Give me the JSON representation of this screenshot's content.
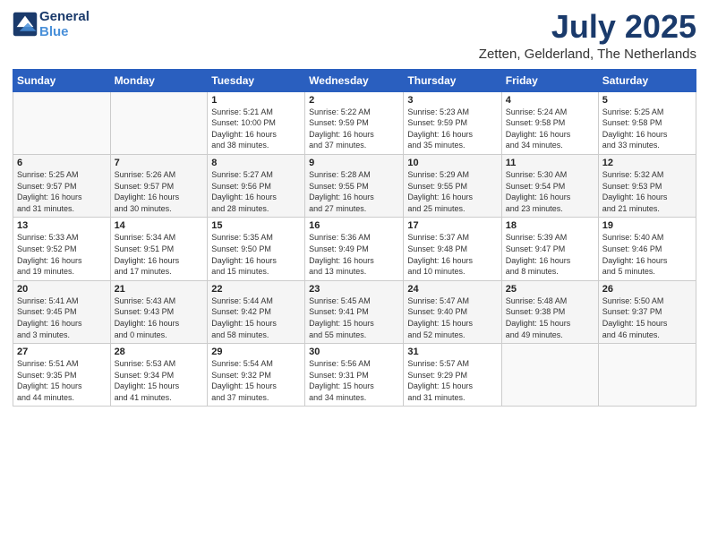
{
  "header": {
    "logo_line1": "General",
    "logo_line2": "Blue",
    "month_year": "July 2025",
    "location": "Zetten, Gelderland, The Netherlands"
  },
  "days_of_week": [
    "Sunday",
    "Monday",
    "Tuesday",
    "Wednesday",
    "Thursday",
    "Friday",
    "Saturday"
  ],
  "weeks": [
    [
      {
        "day": "",
        "info": ""
      },
      {
        "day": "",
        "info": ""
      },
      {
        "day": "1",
        "info": "Sunrise: 5:21 AM\nSunset: 10:00 PM\nDaylight: 16 hours\nand 38 minutes."
      },
      {
        "day": "2",
        "info": "Sunrise: 5:22 AM\nSunset: 9:59 PM\nDaylight: 16 hours\nand 37 minutes."
      },
      {
        "day": "3",
        "info": "Sunrise: 5:23 AM\nSunset: 9:59 PM\nDaylight: 16 hours\nand 35 minutes."
      },
      {
        "day": "4",
        "info": "Sunrise: 5:24 AM\nSunset: 9:58 PM\nDaylight: 16 hours\nand 34 minutes."
      },
      {
        "day": "5",
        "info": "Sunrise: 5:25 AM\nSunset: 9:58 PM\nDaylight: 16 hours\nand 33 minutes."
      }
    ],
    [
      {
        "day": "6",
        "info": "Sunrise: 5:25 AM\nSunset: 9:57 PM\nDaylight: 16 hours\nand 31 minutes."
      },
      {
        "day": "7",
        "info": "Sunrise: 5:26 AM\nSunset: 9:57 PM\nDaylight: 16 hours\nand 30 minutes."
      },
      {
        "day": "8",
        "info": "Sunrise: 5:27 AM\nSunset: 9:56 PM\nDaylight: 16 hours\nand 28 minutes."
      },
      {
        "day": "9",
        "info": "Sunrise: 5:28 AM\nSunset: 9:55 PM\nDaylight: 16 hours\nand 27 minutes."
      },
      {
        "day": "10",
        "info": "Sunrise: 5:29 AM\nSunset: 9:55 PM\nDaylight: 16 hours\nand 25 minutes."
      },
      {
        "day": "11",
        "info": "Sunrise: 5:30 AM\nSunset: 9:54 PM\nDaylight: 16 hours\nand 23 minutes."
      },
      {
        "day": "12",
        "info": "Sunrise: 5:32 AM\nSunset: 9:53 PM\nDaylight: 16 hours\nand 21 minutes."
      }
    ],
    [
      {
        "day": "13",
        "info": "Sunrise: 5:33 AM\nSunset: 9:52 PM\nDaylight: 16 hours\nand 19 minutes."
      },
      {
        "day": "14",
        "info": "Sunrise: 5:34 AM\nSunset: 9:51 PM\nDaylight: 16 hours\nand 17 minutes."
      },
      {
        "day": "15",
        "info": "Sunrise: 5:35 AM\nSunset: 9:50 PM\nDaylight: 16 hours\nand 15 minutes."
      },
      {
        "day": "16",
        "info": "Sunrise: 5:36 AM\nSunset: 9:49 PM\nDaylight: 16 hours\nand 13 minutes."
      },
      {
        "day": "17",
        "info": "Sunrise: 5:37 AM\nSunset: 9:48 PM\nDaylight: 16 hours\nand 10 minutes."
      },
      {
        "day": "18",
        "info": "Sunrise: 5:39 AM\nSunset: 9:47 PM\nDaylight: 16 hours\nand 8 minutes."
      },
      {
        "day": "19",
        "info": "Sunrise: 5:40 AM\nSunset: 9:46 PM\nDaylight: 16 hours\nand 5 minutes."
      }
    ],
    [
      {
        "day": "20",
        "info": "Sunrise: 5:41 AM\nSunset: 9:45 PM\nDaylight: 16 hours\nand 3 minutes."
      },
      {
        "day": "21",
        "info": "Sunrise: 5:43 AM\nSunset: 9:43 PM\nDaylight: 16 hours\nand 0 minutes."
      },
      {
        "day": "22",
        "info": "Sunrise: 5:44 AM\nSunset: 9:42 PM\nDaylight: 15 hours\nand 58 minutes."
      },
      {
        "day": "23",
        "info": "Sunrise: 5:45 AM\nSunset: 9:41 PM\nDaylight: 15 hours\nand 55 minutes."
      },
      {
        "day": "24",
        "info": "Sunrise: 5:47 AM\nSunset: 9:40 PM\nDaylight: 15 hours\nand 52 minutes."
      },
      {
        "day": "25",
        "info": "Sunrise: 5:48 AM\nSunset: 9:38 PM\nDaylight: 15 hours\nand 49 minutes."
      },
      {
        "day": "26",
        "info": "Sunrise: 5:50 AM\nSunset: 9:37 PM\nDaylight: 15 hours\nand 46 minutes."
      }
    ],
    [
      {
        "day": "27",
        "info": "Sunrise: 5:51 AM\nSunset: 9:35 PM\nDaylight: 15 hours\nand 44 minutes."
      },
      {
        "day": "28",
        "info": "Sunrise: 5:53 AM\nSunset: 9:34 PM\nDaylight: 15 hours\nand 41 minutes."
      },
      {
        "day": "29",
        "info": "Sunrise: 5:54 AM\nSunset: 9:32 PM\nDaylight: 15 hours\nand 37 minutes."
      },
      {
        "day": "30",
        "info": "Sunrise: 5:56 AM\nSunset: 9:31 PM\nDaylight: 15 hours\nand 34 minutes."
      },
      {
        "day": "31",
        "info": "Sunrise: 5:57 AM\nSunset: 9:29 PM\nDaylight: 15 hours\nand 31 minutes."
      },
      {
        "day": "",
        "info": ""
      },
      {
        "day": "",
        "info": ""
      }
    ]
  ]
}
